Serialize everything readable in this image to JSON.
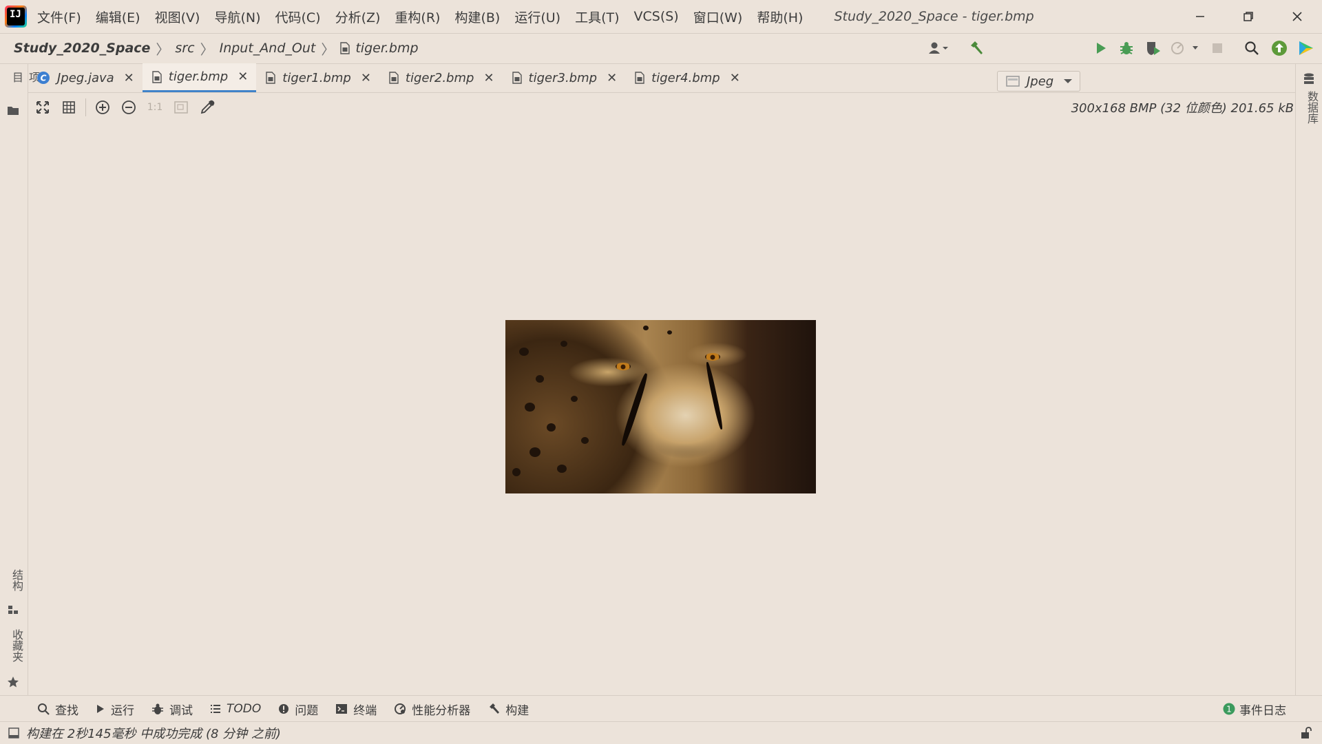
{
  "menubar": {
    "items": [
      "文件(F)",
      "编辑(E)",
      "视图(V)",
      "导航(N)",
      "代码(C)",
      "分析(Z)",
      "重构(R)",
      "构建(B)",
      "运行(U)",
      "工具(T)",
      "VCS(S)",
      "窗口(W)",
      "帮助(H)"
    ],
    "title": "Study_2020_Space - tiger.bmp"
  },
  "breadcrumb": [
    "Study_2020_Space",
    "src",
    "Input_And_Out",
    "tiger.bmp"
  ],
  "toolbar": {
    "run_config": "Jpeg"
  },
  "left_strip": {
    "project": "项目",
    "structure": "结构",
    "favorites": "收藏夹"
  },
  "right_strip": {
    "database": "数据库"
  },
  "tabs": [
    {
      "label": "Jpeg.java",
      "active": false,
      "icon": "java-class-icon"
    },
    {
      "label": "tiger.bmp",
      "active": true,
      "icon": "image-file-icon"
    },
    {
      "label": "tiger1.bmp",
      "active": false,
      "icon": "image-file-icon"
    },
    {
      "label": "tiger2.bmp",
      "active": false,
      "icon": "image-file-icon"
    },
    {
      "label": "tiger3.bmp",
      "active": false,
      "icon": "image-file-icon"
    },
    {
      "label": "tiger4.bmp",
      "active": false,
      "icon": "image-file-icon"
    }
  ],
  "image_toolbar": {
    "actual_size": "1:1"
  },
  "image_info": "300x168 BMP (32 位颜色) 201.65 kB",
  "bottom_tools": [
    {
      "label": "查找",
      "icon": "search-icon"
    },
    {
      "label": "运行",
      "icon": "run-icon"
    },
    {
      "label": "调试",
      "icon": "bug-icon"
    },
    {
      "label": "TODO",
      "icon": "list-icon"
    },
    {
      "label": "问题",
      "icon": "problems-icon"
    },
    {
      "label": "终端",
      "icon": "terminal-icon"
    },
    {
      "label": "性能分析器",
      "icon": "profiler-icon"
    },
    {
      "label": "构建",
      "icon": "hammer-icon"
    }
  ],
  "event_log": {
    "label": "事件日志",
    "count": "1"
  },
  "status": "构建在 2秒145毫秒 中成功完成 (8 分钟 之前)",
  "colors": {
    "accent": "#4083c9",
    "run_green": "#499c54",
    "background": "#ece3da"
  }
}
